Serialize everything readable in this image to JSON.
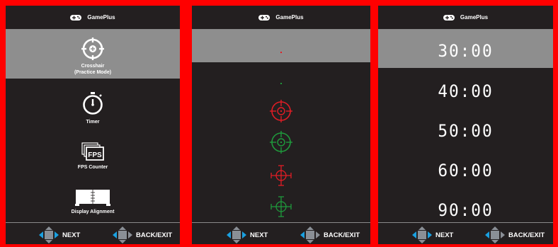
{
  "header": {
    "title": "GamePlus",
    "icon": "gamepad-icon"
  },
  "footer": {
    "next_label": "NEXT",
    "back_label": "BACK/EXIT",
    "icon": "dpad-icon"
  },
  "menu": {
    "items": [
      {
        "label_line1": "Crosshair",
        "label_line2": "(Practice Mode)",
        "icon": "crosshair-icon",
        "selected": true
      },
      {
        "label_line1": "Timer",
        "label_line2": "",
        "icon": "stopwatch-icon",
        "selected": false
      },
      {
        "label_line1": "FPS Counter",
        "label_line2": "",
        "icon": "fps-icon",
        "selected": false,
        "icon_text": "FPS"
      },
      {
        "label_line1": "Display Alignment",
        "label_line2": "",
        "icon": "alignment-icon",
        "selected": false
      }
    ]
  },
  "crosshairs": {
    "items": [
      {
        "name": "red-dot",
        "color": "#e21d25",
        "selected": true
      },
      {
        "name": "green-dot",
        "color": "#1f9a3c",
        "selected": false
      },
      {
        "name": "red-circle-crosshair",
        "color": "#e21d25",
        "selected": false
      },
      {
        "name": "green-circle-crosshair",
        "color": "#1f9a3c",
        "selected": false
      },
      {
        "name": "red-bracket-crosshair",
        "color": "#e21d25",
        "selected": false
      },
      {
        "name": "green-bracket-crosshair",
        "color": "#1f9a3c",
        "selected": false
      }
    ]
  },
  "timer": {
    "options": [
      "30:00",
      "40:00",
      "50:00",
      "60:00",
      "90:00"
    ],
    "selected_index": 0
  },
  "colors": {
    "frame": "#ff0000",
    "panel": "#231f20",
    "highlight": "#8e8e8e",
    "accent_blue": "#1aa0e0"
  }
}
